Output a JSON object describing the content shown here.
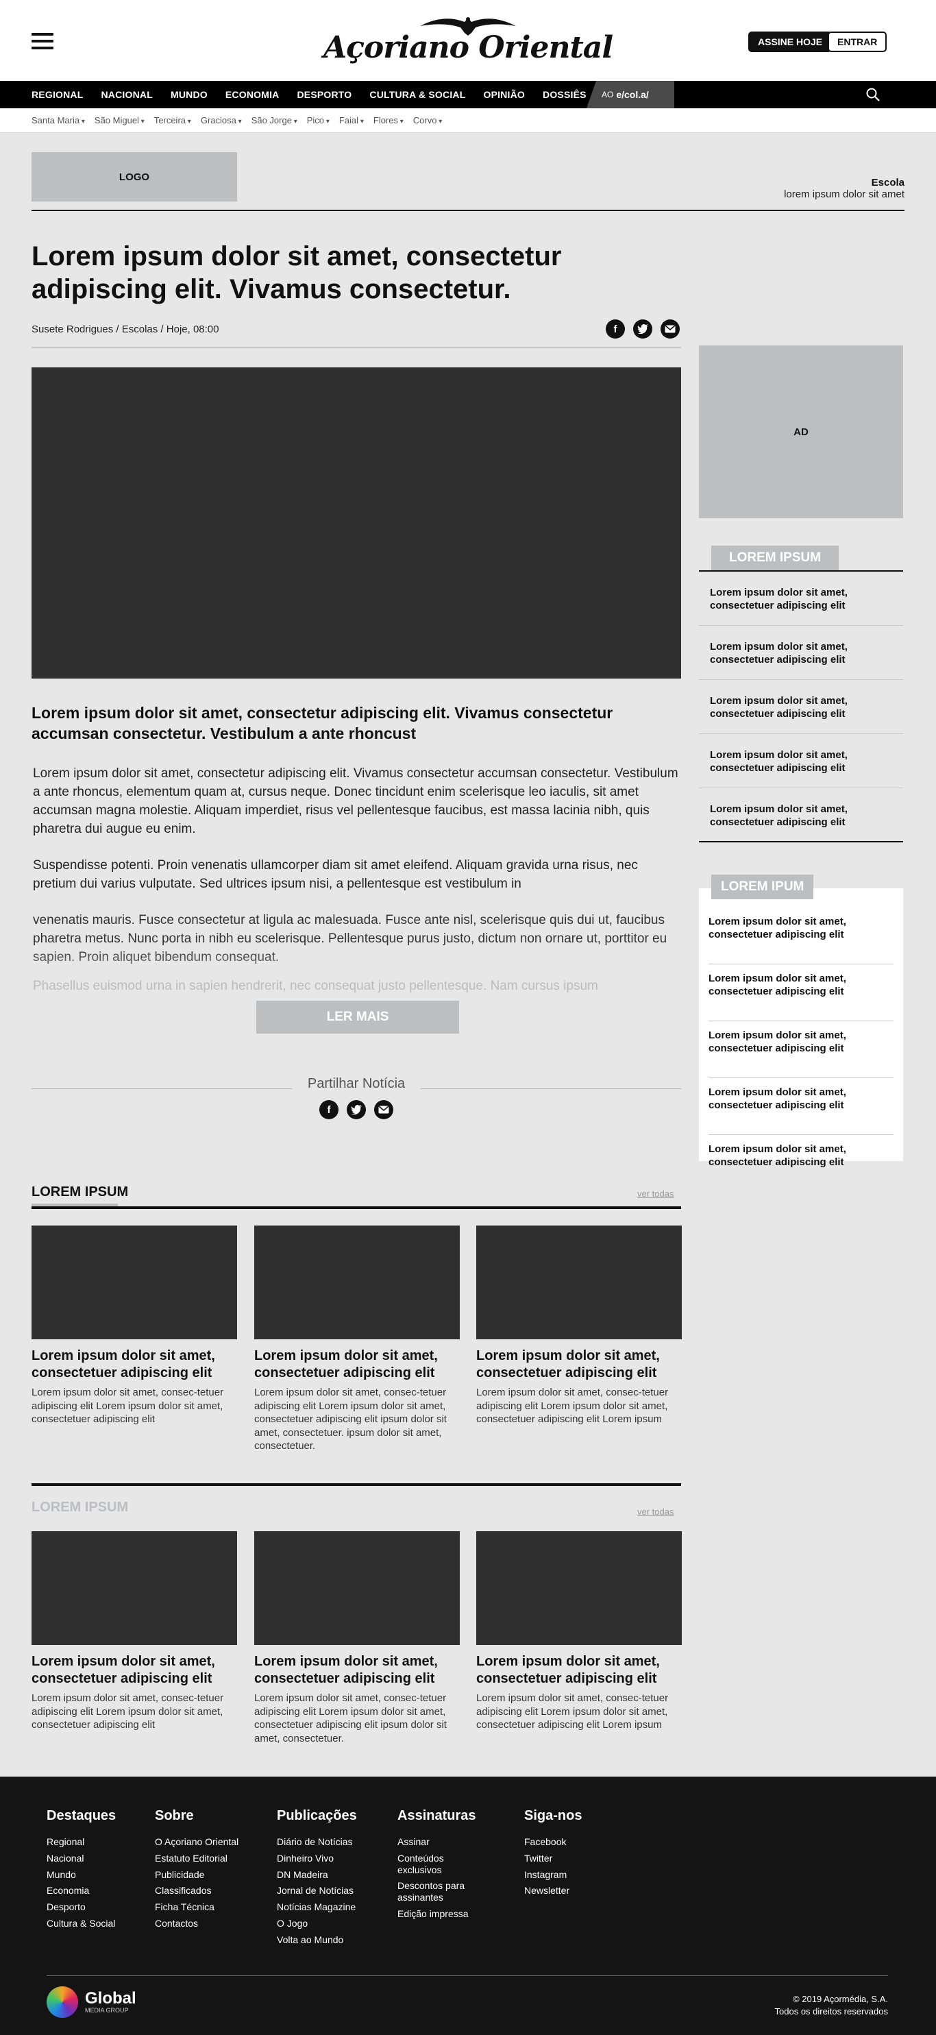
{
  "header": {
    "brand": "Açoriano Oriental",
    "subscribe_label": "ASSINE HOJE",
    "login_label": "ENTRAR"
  },
  "main_nav": [
    "REGIONAL",
    "NACIONAL",
    "MUNDO",
    "ECONOMIA",
    "DESPORTO",
    "CULTURA & SOCIAL",
    "OPINIÃO",
    "DOSSIÊS"
  ],
  "escolas_tab": {
    "prefix": "AO",
    "label": "e/col.a/"
  },
  "islands_nav": [
    "Santa Maria",
    "São Miguel",
    "Terceira",
    "Graciosa",
    "São Jorge",
    "Pico",
    "Faial",
    "Flores",
    "Corvo"
  ],
  "school": {
    "logo_label": "LOGO",
    "name": "Escola",
    "description": "lorem ipsum dolor sit amet"
  },
  "article": {
    "title": "Lorem ipsum dolor sit amet, consectetur adipiscing elit. Vivamus consectetur.",
    "byline": "Susete Rodrigues / Escolas /  Hoje, 08:00",
    "lead": "Lorem ipsum dolor sit amet, consectetur adipiscing elit. Vivamus consectetur accumsan consectetur. Vestibulum a ante rhoncust",
    "paragraphs": [
      "Lorem ipsum dolor sit amet, consectetur adipiscing elit. Vivamus consectetur accumsan consectetur. Vestibulum a ante rhoncus, elementum quam at, cursus neque. Donec tincidunt enim scelerisque leo iaculis, sit amet accumsan magna molestie. Aliquam imperdiet, risus vel pellentesque faucibus, est massa lacinia nibh, quis pharetra dui augue eu enim.",
      "Suspendisse potenti. Proin venenatis ullamcorper diam sit amet eleifend. Aliquam gravida urna risus, nec pretium dui varius vulputate. Sed ultrices ipsum nisi, a pellentesque est vestibulum in",
      "venenatis mauris. Fusce consectetur at ligula ac malesuada. Fusce ante nisl, scelerisque quis dui ut, faucibus pharetra metus. Nunc porta in nibh eu scelerisque. Pellentesque purus justo, dictum non ornare ut, porttitor eu sapien. Proin aliquet bibendum consequat."
    ],
    "faded_line": "Phasellus euismod urna in sapien hendrerit, nec consequat justo pellentesque. Nam cursus ipsum",
    "read_more_label": "LER MAIS",
    "share_title": "Partilhar Notícia"
  },
  "sidebar": {
    "ad_label": "AD",
    "block1": {
      "tab": "LOREM IPSUM",
      "items": [
        "Lorem ipsum dolor sit amet, consectetuer adipiscing elit",
        "Lorem ipsum dolor sit amet, consectetuer adipiscing elit",
        "Lorem ipsum dolor sit amet, consectetuer adipiscing elit",
        "Lorem ipsum dolor sit amet, consectetuer adipiscing elit",
        "Lorem ipsum dolor sit amet, consectetuer adipiscing elit"
      ]
    },
    "block2": {
      "tab": "LOREM IPUM",
      "items": [
        "Lorem ipsum dolor sit amet, consectetuer adipiscing elit",
        "Lorem ipsum dolor sit amet, consectetuer adipiscing elit",
        "Lorem ipsum dolor sit amet, consectetuer adipiscing elit",
        "Lorem ipsum dolor sit amet, consectetuer adipiscing elit",
        "Lorem ipsum dolor sit amet, consectetuer adipiscing elit"
      ]
    }
  },
  "related1": {
    "title": "LOREM IPSUM",
    "see_all": "ver todas",
    "cards": [
      {
        "title": "Lorem ipsum dolor sit amet, consectetuer adipiscing elit",
        "text": "Lorem ipsum dolor sit amet, consec-tetuer adipiscing elit Lorem ipsum dolor sit amet, consectetuer adipiscing elit"
      },
      {
        "title": "Lorem ipsum dolor sit amet, consectetuer adipiscing elit",
        "text": "Lorem ipsum dolor sit amet, consec-tetuer adipiscing elit Lorem ipsum dolor sit amet, consectetuer adipiscing elit ipsum dolor sit amet, consectetuer. ipsum dolor sit amet, consectetuer."
      },
      {
        "title": "Lorem ipsum dolor sit amet, consectetuer adipiscing elit",
        "text": "Lorem ipsum dolor sit amet, consec-tetuer adipiscing elit Lorem ipsum dolor sit amet, consectetuer adipiscing elit Lorem ipsum"
      }
    ]
  },
  "related2": {
    "title": "LOREM IPSUM",
    "see_all": "ver todas",
    "cards": [
      {
        "title": "Lorem ipsum dolor sit amet, consectetuer adipiscing elit",
        "text": "Lorem ipsum dolor sit amet, consec-tetuer adipiscing elit Lorem ipsum dolor sit amet, consectetuer adipiscing elit"
      },
      {
        "title": "Lorem ipsum dolor sit amet, consectetuer adipiscing elit",
        "text": "Lorem ipsum dolor sit amet, consec-tetuer adipiscing elit Lorem ipsum dolor sit amet, consectetuer adipiscing elit ipsum dolor sit amet, consectetuer."
      },
      {
        "title": "Lorem ipsum dolor sit amet, consectetuer adipiscing elit",
        "text": "Lorem ipsum dolor sit amet, consec-tetuer adipiscing elit Lorem ipsum dolor sit amet, consectetuer adipiscing elit Lorem ipsum"
      }
    ]
  },
  "footer": {
    "columns": [
      {
        "title": "Destaques",
        "links": [
          "Regional",
          "Nacional",
          "Mundo",
          "Economia",
          "Desporto",
          "Cultura & Social"
        ]
      },
      {
        "title": "Sobre",
        "links": [
          "O Açoriano Oriental",
          "Estatuto Editorial",
          "Publicidade",
          "Classificados",
          "Ficha Técnica",
          "Contactos"
        ]
      },
      {
        "title": "Publicações",
        "links": [
          "Diário de Notícias",
          "Dinheiro Vivo",
          "DN Madeira",
          "Jornal de Notícias",
          "Notícias Magazine",
          "O Jogo",
          "Volta ao Mundo"
        ]
      },
      {
        "title": "Assinaturas",
        "links": [
          "Assinar",
          "Conteúdos exclusivos",
          "Descontos para assinantes",
          "Edição impressa"
        ]
      },
      {
        "title": "Siga-nos",
        "links": [
          "Facebook",
          "Twitter",
          "Instagram",
          "Newsletter"
        ]
      }
    ],
    "group_name": "Global",
    "group_sub": "MEDIA GROUP",
    "copyright_line1": "© 2019 Açormédia, S.A.",
    "copyright_line2": "Todos os direitos reservados"
  },
  "colors": {
    "page_bg": "#e8e7e8",
    "nav_bg": "#000000",
    "placeholder_grey": "#bdbebf",
    "image_dark": "#2f2f2f",
    "footer_bg": "#141414"
  }
}
